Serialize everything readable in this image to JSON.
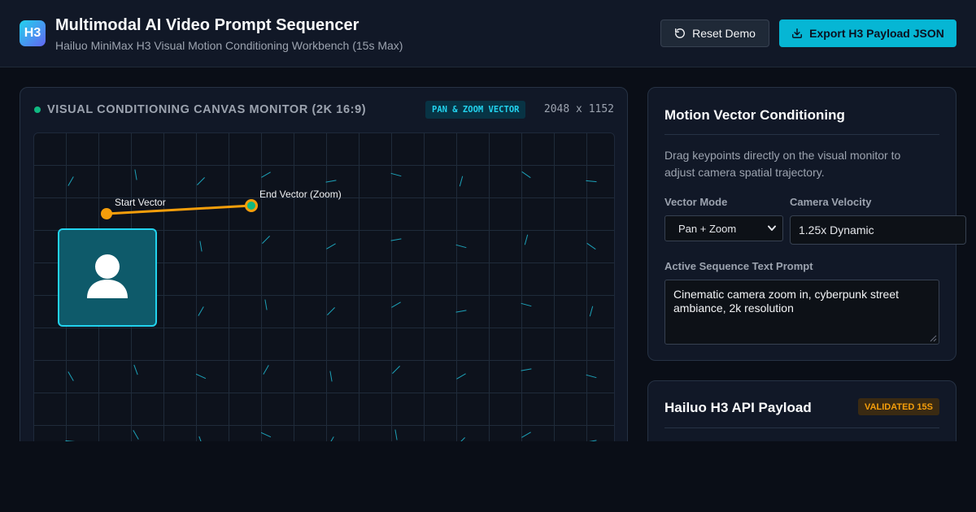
{
  "header": {
    "logo_text": "H3",
    "title": "Multimodal AI Video Prompt Sequencer",
    "subtitle": "Hailuo MiniMax H3 Visual Motion Conditioning Workbench (15s Max)",
    "reset_label": "Reset Demo",
    "export_label": "Export H3 Payload JSON",
    "reset_icon": "rotate-ccw-icon",
    "export_icon": "download-icon"
  },
  "canvas": {
    "title": "VISUAL CONDITIONING CANVAS MONITOR (2K 16:9)",
    "mode_badge": "PAN & ZOOM VECTOR",
    "resolution": "2048 x 1152",
    "status_color": "#10b981",
    "start_label": "Start Vector",
    "end_label": "End Vector (Zoom)",
    "subject_icon": "user-icon",
    "vector_color": "#f59e0b",
    "accent_color": "#22d3ee"
  },
  "motion": {
    "title": "Motion Vector Conditioning",
    "help_text": "Drag keypoints directly on the visual monitor to adjust camera spatial trajectory.",
    "mode_label": "Vector Mode",
    "mode_value": "Pan + Zoom",
    "velocity_label": "Camera Velocity",
    "velocity_value": "1.25x Dynamic",
    "prompt_label": "Active Sequence Text Prompt",
    "prompt_value": "Cinematic camera zoom in, cyberpunk street ambiance, 2k resolution"
  },
  "payload": {
    "title": "Hailuo H3 API Payload",
    "status": "VALIDATED 15S",
    "status_color": "#f59e0b"
  }
}
